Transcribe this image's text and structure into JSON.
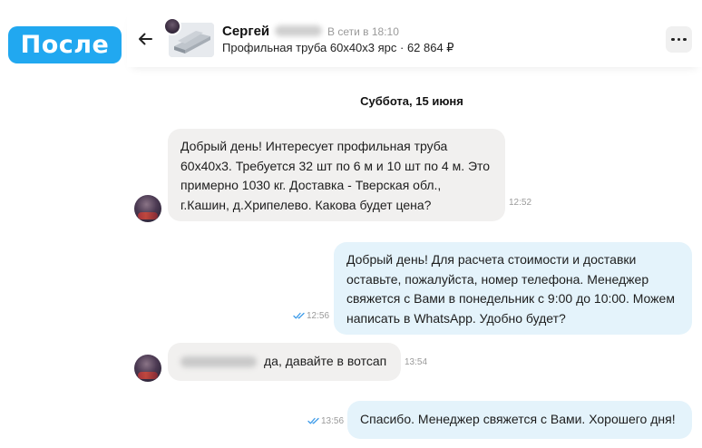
{
  "badge": "После",
  "header": {
    "name": "Сергей",
    "status": "В сети в 18:10",
    "product": "Профильная труба 60х40х3 ярс · 62 864 ₽"
  },
  "date_separator": "Суббота, 15 июня",
  "messages": [
    {
      "direction": "incoming",
      "lines": [
        "Добрый день! Интересует профильная труба",
        "60х40х3. Требуется 32 шт по 6 м и 10 шт по 4 м. Это",
        "примерно 1030 кг. Доставка - Тверская обл.,",
        "г.Кашин, д.Хрипелево. Какова будет цена?"
      ],
      "time": "12:52"
    },
    {
      "direction": "outgoing",
      "lines": [
        "Добрый день! Для расчета стоимости и доставки",
        "оставьте, пожалуйста, номер телефона. Менеджер",
        "свяжется с Вами в понедельник с 9:00 до 10:00. Можем",
        "написать в WhatsApp. Удобно будет?"
      ],
      "time": "12:56"
    },
    {
      "direction": "incoming",
      "text": "да, давайте в вотсап",
      "time": "13:54"
    },
    {
      "direction": "outgoing",
      "text": "Спасибо. Менеджер свяжется с Вами. Хорошего дня!",
      "time": "13:56"
    }
  ],
  "colors": {
    "badge": "#21a8f0",
    "incoming_bubble": "#f1f0ef",
    "outgoing_bubble": "#e4f3fb",
    "read_check": "#3d9be9"
  },
  "icons": [
    "back-arrow-icon",
    "more-dots-icon",
    "double-check-icon"
  ]
}
